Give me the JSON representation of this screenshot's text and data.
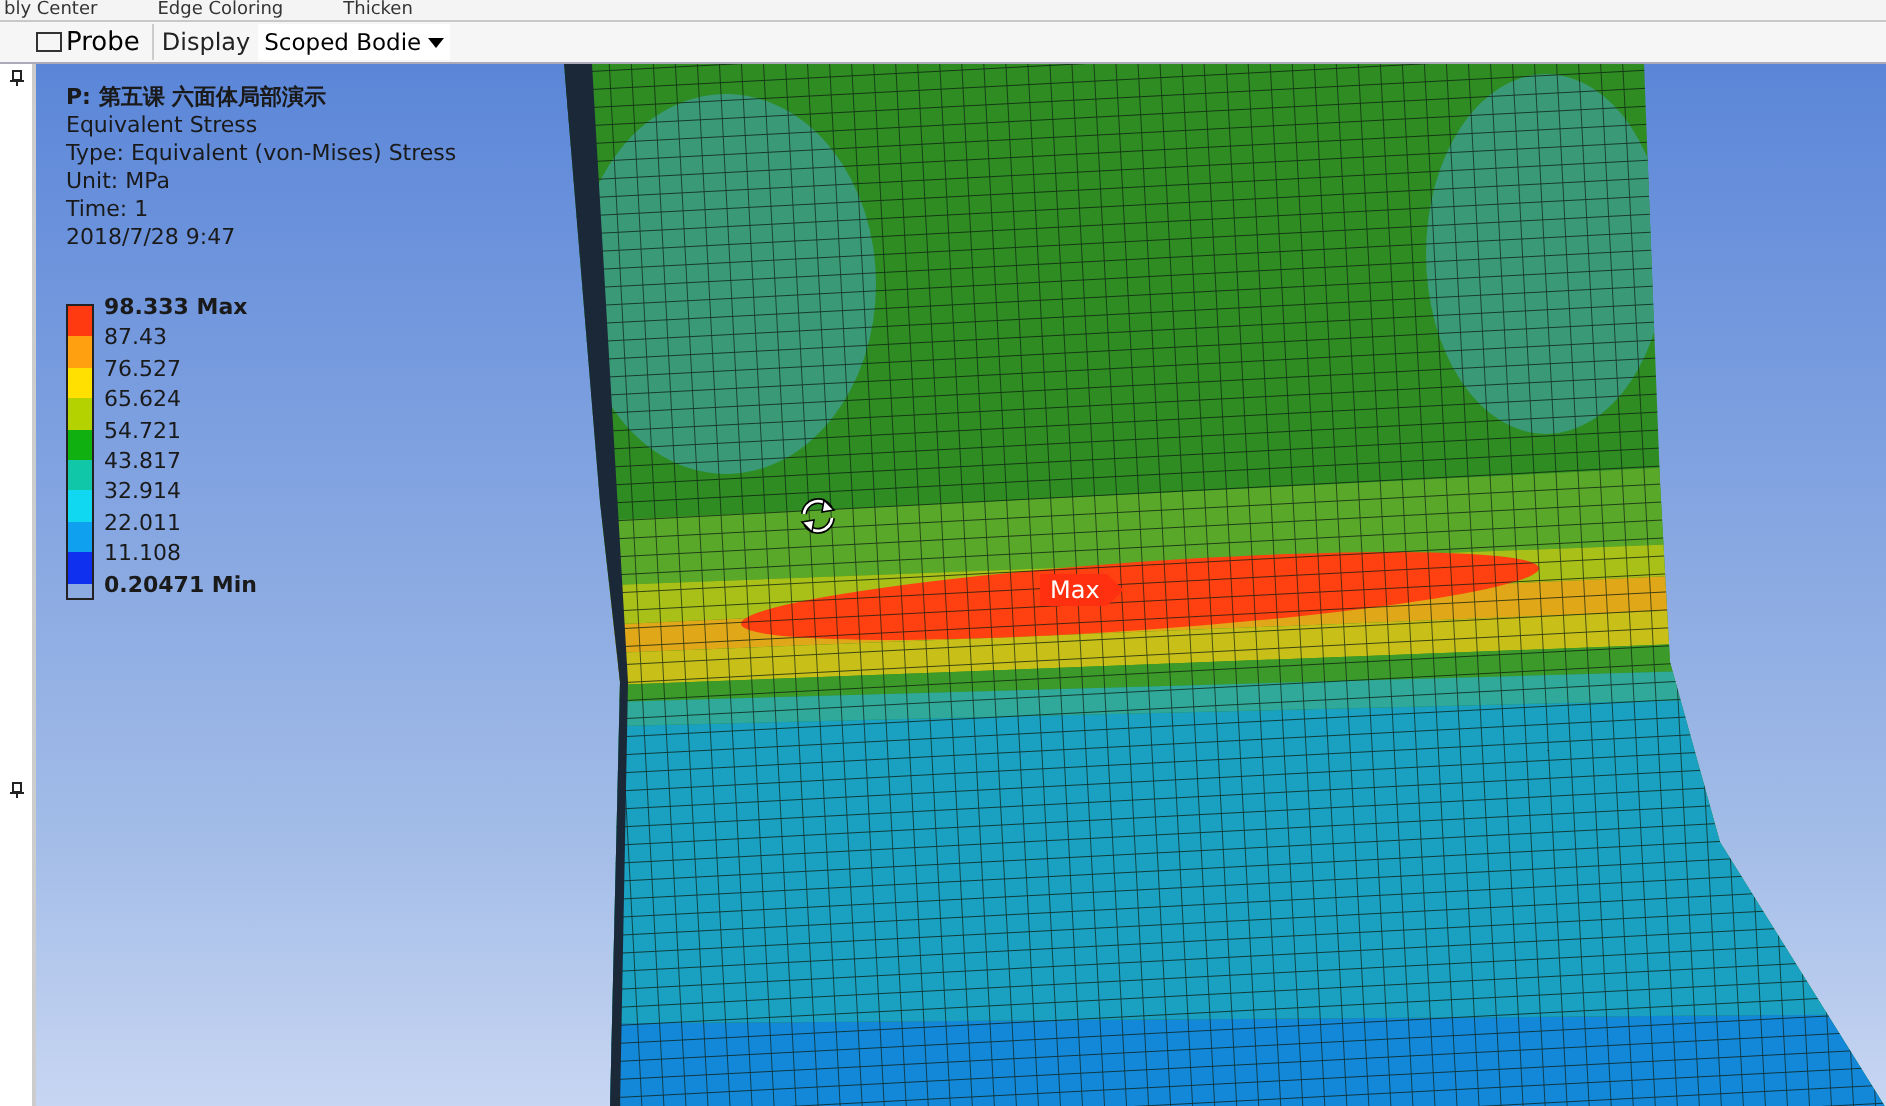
{
  "top_toolbar": {
    "items": [
      "bly Center",
      "Edge Coloring",
      "Thicken"
    ]
  },
  "toolbar": {
    "probe_button": "Probe",
    "display_label": "Display",
    "scope_dropdown": {
      "value": "Scoped Bodie"
    }
  },
  "legend": {
    "title": "P: 第五课 六面体局部演示",
    "lines": [
      "Equivalent Stress",
      "Type: Equivalent (von-Mises) Stress",
      "Unit: MPa",
      "Time: 1",
      "2018/7/28 9:47"
    ],
    "swatches": [
      {
        "color": "#ff3a10"
      },
      {
        "color": "#ffa010"
      },
      {
        "color": "#ffe000"
      },
      {
        "color": "#b4d200"
      },
      {
        "color": "#10b010"
      },
      {
        "color": "#10c8a8"
      },
      {
        "color": "#10d8f0"
      },
      {
        "color": "#10a0f0"
      },
      {
        "color": "#1030f0"
      }
    ],
    "labels": [
      "98.333 Max",
      "87.43",
      "76.527",
      "65.624",
      "54.721",
      "43.817",
      "32.914",
      "22.011",
      "11.108",
      "0.20471 Min"
    ]
  },
  "max_marker": "Max"
}
